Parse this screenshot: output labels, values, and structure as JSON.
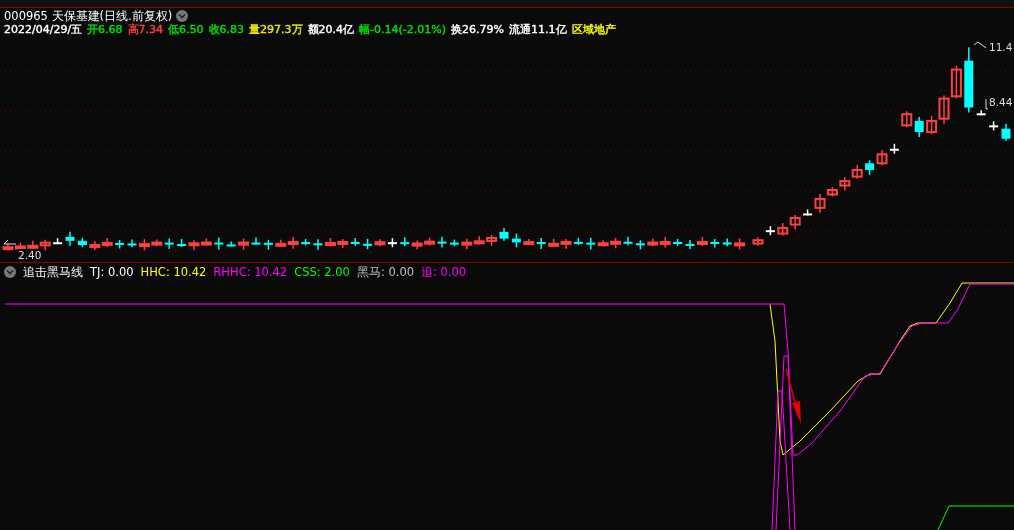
{
  "stock_header": {
    "title": "000965 天保基建(日线.前复权)",
    "quote": [
      {
        "text": "2022/04/29/五",
        "color": "#ffffff"
      },
      {
        "text": "开6.68",
        "color": "#00e000"
      },
      {
        "text": "高7.34",
        "color": "#ff4040"
      },
      {
        "text": "低6.50",
        "color": "#00e000"
      },
      {
        "text": "收6.83",
        "color": "#00e000"
      },
      {
        "text": "量297.3万",
        "color": "#e8e800"
      },
      {
        "text": "额20.4亿",
        "color": "#ffffff"
      },
      {
        "text": "幅-0.14(-2.01%)",
        "color": "#00e000"
      },
      {
        "text": "换26.79%",
        "color": "#ffffff"
      },
      {
        "text": "流通11.1亿",
        "color": "#ffffff"
      },
      {
        "text": "区域地产",
        "color": "#ffff00"
      }
    ]
  },
  "price_chart": {
    "high_label": "11.4",
    "last_label": "8.44",
    "low_label": "2.40"
  },
  "indicator": {
    "name": "追击黑马线",
    "values": [
      {
        "text": "TJ: 0.00",
        "color": "#ffffff"
      },
      {
        "text": "HHC: 10.42",
        "color": "#ffff00"
      },
      {
        "text": "RHHC: 10.42",
        "color": "#ff00ff"
      },
      {
        "text": "CSS: 2.00",
        "color": "#00ff00"
      },
      {
        "text": "黑马: 0.00",
        "color": "#c0c0c0"
      },
      {
        "text": "追: 0.00",
        "color": "#ff00ff"
      }
    ]
  }
}
